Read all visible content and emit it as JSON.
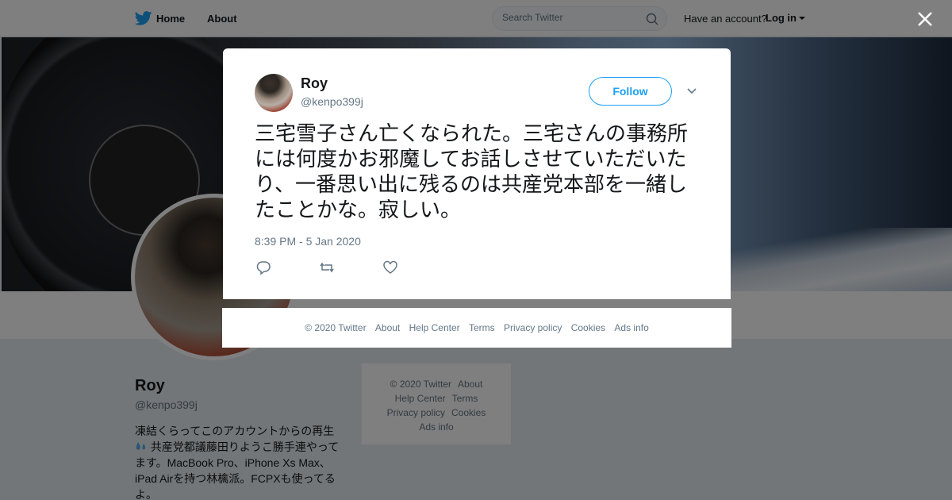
{
  "nav": {
    "home_label": "Home",
    "about_label": "About",
    "search_placeholder": "Search Twitter",
    "have_account": "Have an account?",
    "login_label": "Log in"
  },
  "profile": {
    "name": "Roy",
    "handle": "@kenpo399j",
    "bio_line1": "凍結くらってこのアカウントからの再生",
    "bio_line2": "共産党都議藤田りようこ勝手連やってます。MacBook Pro、iPhone Xs Max、iPad Airを持つ林檎派。FCPXも使ってるよ。"
  },
  "side_footer": {
    "copyright": "© 2020 Twitter",
    "about": "About",
    "help": "Help Center",
    "terms": "Terms",
    "privacy": "Privacy policy",
    "cookies": "Cookies",
    "ads": "Ads info"
  },
  "tweet": {
    "name": "Roy",
    "handle": "@kenpo399j",
    "follow_label": "Follow",
    "text": "三宅雪子さん亡くなられた。三宅さんの事務所には何度かお邪魔してお話しさせていただいたり、一番思い出に残るのは共産党本部を一緒したことかな。寂しい。",
    "timestamp": "8:39 PM - 5 Jan 2020"
  },
  "modal_footer": {
    "copyright": "© 2020 Twitter",
    "about": "About",
    "help": "Help Center",
    "terms": "Terms",
    "privacy": "Privacy policy",
    "cookies": "Cookies",
    "ads": "Ads info"
  },
  "colors": {
    "brand": "#1da1f2",
    "text": "#14171a",
    "muted": "#657786"
  }
}
